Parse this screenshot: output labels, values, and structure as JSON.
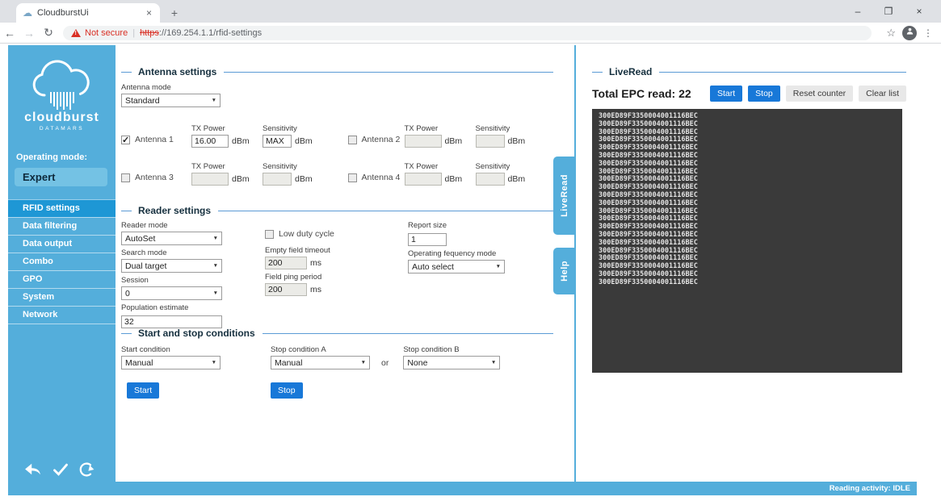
{
  "browser": {
    "tab_title": "CloudburstUi",
    "tab_close": "×",
    "new_tab": "+",
    "window_controls": {
      "minimize": "–",
      "restore": "❐",
      "close": "×"
    },
    "nav": {
      "back": "←",
      "forward": "→",
      "refresh": "↻"
    },
    "address": {
      "warning_mark": "!",
      "not_secure": "Not secure",
      "divider": "|",
      "protocol": "https",
      "rest": "://169.254.1.1/rfid-settings"
    },
    "star": "☆",
    "menu": "⋮"
  },
  "sidebar": {
    "logo_word": "cloudburst",
    "logo_sub": "DATAMARS",
    "operating_mode_label": "Operating mode:",
    "operating_mode_value": "Expert",
    "items": [
      {
        "label": "RFID settings",
        "active": true
      },
      {
        "label": "Data filtering",
        "active": false
      },
      {
        "label": "Data output",
        "active": false
      },
      {
        "label": "Combo",
        "active": false
      },
      {
        "label": "GPO",
        "active": false
      },
      {
        "label": "System",
        "active": false
      },
      {
        "label": "Network",
        "active": false
      }
    ]
  },
  "antenna_settings": {
    "title": "Antenna settings",
    "antenna_mode_label": "Antenna mode",
    "antenna_mode_value": "Standard",
    "tx_power_label": "TX Power",
    "sensitivity_label": "Sensitivity",
    "dbm_unit": "dBm",
    "antennas": [
      {
        "label": "Antenna 1",
        "checked": true,
        "tx_power": "16.00",
        "sensitivity": "MAX"
      },
      {
        "label": "Antenna 2",
        "checked": false,
        "tx_power": "",
        "sensitivity": ""
      },
      {
        "label": "Antenna 3",
        "checked": false,
        "tx_power": "",
        "sensitivity": ""
      },
      {
        "label": "Antenna 4",
        "checked": false,
        "tx_power": "",
        "sensitivity": ""
      }
    ]
  },
  "reader_settings": {
    "title": "Reader settings",
    "reader_mode_label": "Reader mode",
    "reader_mode_value": "AutoSet",
    "search_mode_label": "Search mode",
    "search_mode_value": "Dual target",
    "session_label": "Session",
    "session_value": "0",
    "population_label": "Population estimate",
    "population_value": "32",
    "low_duty_label": "Low duty cycle",
    "empty_field_label": "Empty field timeout",
    "empty_field_value": "200",
    "field_ping_label": "Field ping period",
    "field_ping_value": "200",
    "ms_unit": "ms",
    "report_size_label": "Report size",
    "report_size_value": "1",
    "freq_mode_label": "Operating fequency mode",
    "freq_mode_value": "Auto select"
  },
  "start_stop": {
    "title": "Start and stop conditions",
    "start_condition_label": "Start condition",
    "start_condition_value": "Manual",
    "stop_a_label": "Stop condition A",
    "stop_a_value": "Manual",
    "or_text": "or",
    "stop_b_label": "Stop condition B",
    "stop_b_value": "None",
    "start_button": "Start",
    "stop_button": "Stop"
  },
  "side_tabs": {
    "liveread": "LiveRead",
    "help": "Help"
  },
  "liveread": {
    "title": "LiveRead",
    "total_label": "Total EPC read:",
    "total_value": "22",
    "start_button": "Start",
    "stop_button": "Stop",
    "reset_button": "Reset counter",
    "clear_button": "Clear list",
    "epc_value": "300ED89F3350004001116BEC",
    "epc_count": 22
  },
  "status_bar": {
    "reading_activity": "Reading activity: IDLE"
  },
  "colors": {
    "sidebar_blue": "#54aedb",
    "active_nav_blue": "#1e97d5",
    "button_blue": "#1878d8",
    "legend_line_blue": "#5b9bd5",
    "dark_panel": "#3a3a3a",
    "warning_red": "#d93025"
  }
}
